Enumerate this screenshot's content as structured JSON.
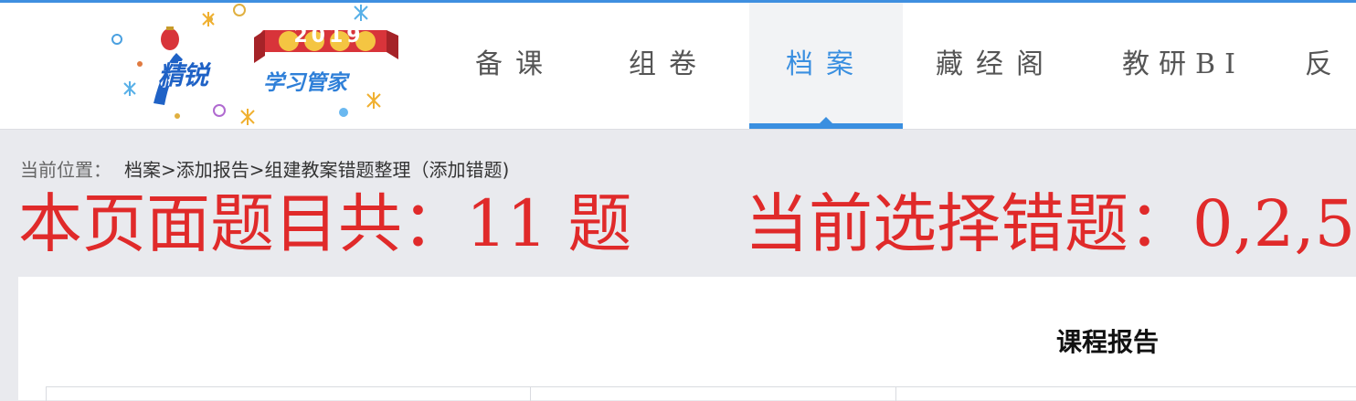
{
  "logo": {
    "brand": "精锐",
    "tagline": "学习管家",
    "year": "2019"
  },
  "nav": {
    "items": [
      {
        "label": "备课",
        "active": false
      },
      {
        "label": "组卷",
        "active": false
      },
      {
        "label": "档案",
        "active": true
      },
      {
        "label": "藏经阁",
        "active": false
      },
      {
        "label": "教研BI",
        "active": false
      },
      {
        "label": "反",
        "active": false
      }
    ]
  },
  "breadcrumb": {
    "prefix": "当前位置：",
    "path": "档案>添加报告>组建教案错题整理（添加错题)"
  },
  "info": {
    "count_text": "本页面题目共：11 题",
    "selected_text": "当前选择错题：0,2,5"
  },
  "card": {
    "title": "课程报告"
  },
  "colors": {
    "accent": "#3a8fe0",
    "highlight_red": "#e02a2a",
    "page_bg": "#e9eaee"
  }
}
